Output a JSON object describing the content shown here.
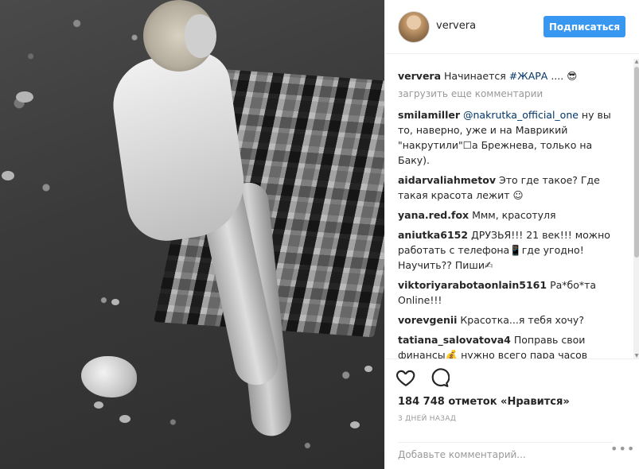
{
  "post": {
    "username": "ververa",
    "follow_label": "Подписаться",
    "caption_author": "ververa",
    "caption_text": "Начинается ",
    "caption_tag": "#ЖАРА",
    "caption_tail": " .... 😎",
    "load_more": "загрузить еще комментарии"
  },
  "comments": [
    {
      "author": "smilamiller",
      "mention": "@nakrutka_official_one",
      "text": " ну вы то, наверно, уже и на Маврикий \"накрутили\"☐а Брежнева, только на Баку)."
    },
    {
      "author": "aidarvaliahmetov",
      "mention": "",
      "text": "Это где такое? Где такая красота лежит ☺"
    },
    {
      "author": "yana.red.fox",
      "mention": "",
      "text": "Ммм, красотуля"
    },
    {
      "author": "aniutka6152",
      "mention": "",
      "text": "ДРУЗЬЯ!!! 21 век!!! можно работать с телефона📱где угодно! Научить?? Пиши✍"
    },
    {
      "author": "viktoriyarabotaonlain5161",
      "mention": "",
      "text": "Ра*бо*та Online!!!"
    },
    {
      "author": "vorevgenii",
      "mention": "",
      "text": "Красотка...я тебя хочу?"
    },
    {
      "author": "tatiana_salovatova4",
      "mention": "",
      "text": "Поправь свои финансы💰 нужно всего пара часов времени⏳ в день 👉 #work_from_net"
    }
  ],
  "actions": {
    "likes": "184 748 отметок «Нравится»",
    "date": "3 ДНЕЙ НАЗАД",
    "add_comment_placeholder": "Добавьте комментарий...",
    "more": "•••"
  },
  "icons": {
    "like": "heart-outline-icon",
    "comment": "speech-bubble-icon"
  },
  "colors": {
    "accent": "#3897f0",
    "link": "#003569",
    "muted": "#999999"
  }
}
